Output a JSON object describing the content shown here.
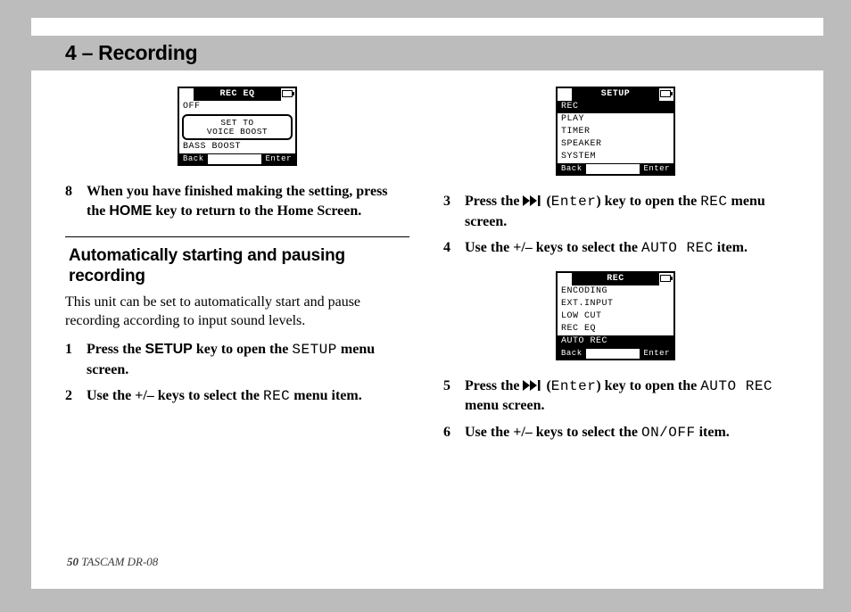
{
  "chapter": "4 – Recording",
  "lcd1": {
    "title": "REC EQ",
    "row_off": "OFF",
    "popup_line1": "SET TO",
    "popup_line2": "VOICE BOOST",
    "row_bass": "BASS BOOST",
    "back": "Back",
    "enter": "Enter"
  },
  "lcd2": {
    "title": "SETUP",
    "rows": [
      "REC",
      "PLAY",
      "TIMER",
      "SPEAKER",
      "SYSTEM"
    ],
    "selected_index": 0,
    "back": "Back",
    "enter": "Enter"
  },
  "lcd3": {
    "title": "REC",
    "rows": [
      "ENCODING",
      "EXT.INPUT",
      "LOW CUT",
      "REC EQ",
      "AUTO REC"
    ],
    "selected_index": 4,
    "back": "Back",
    "enter": "Enter"
  },
  "left": {
    "step8_a": "When you have finished making the setting, press the ",
    "step8_key": "HOME",
    "step8_b": " key to return to the Home Screen.",
    "subhead": "Automatically starting and pausing recording",
    "para": "This unit can be set to automatically start and pause recording according to input sound levels.",
    "step1_a": "Press the ",
    "step1_key": "SETUP",
    "step1_b": " key to open the ",
    "step1_lcd": "SETUP",
    "step1_c": " menu screen.",
    "step2_a": "Use the +/– keys to select the ",
    "step2_lcd": "REC",
    "step2_b": " menu item."
  },
  "right": {
    "step3_a": "Press the ",
    "step3_enter": "Enter",
    "step3_b": ") key to open the ",
    "step3_lcd": "REC",
    "step3_c": " menu screen.",
    "step4_a": "Use the +/– keys to select the ",
    "step4_lcd": "AUTO REC",
    "step4_b": " item.",
    "step5_a": "Press the ",
    "step5_enter": "Enter",
    "step5_b": ") key to open the ",
    "step5_lcd": "AUTO REC",
    "step5_c": " menu screen.",
    "step6_a": "Use the +/– keys to select the ",
    "step6_lcd": "ON/OFF",
    "step6_b": " item."
  },
  "nums": {
    "n8": "8",
    "n1": "1",
    "n2": "2",
    "n3": "3",
    "n4": "4",
    "n5": "5",
    "n6": "6"
  },
  "footer": {
    "page": "50",
    "model": " TASCAM  DR-08"
  }
}
